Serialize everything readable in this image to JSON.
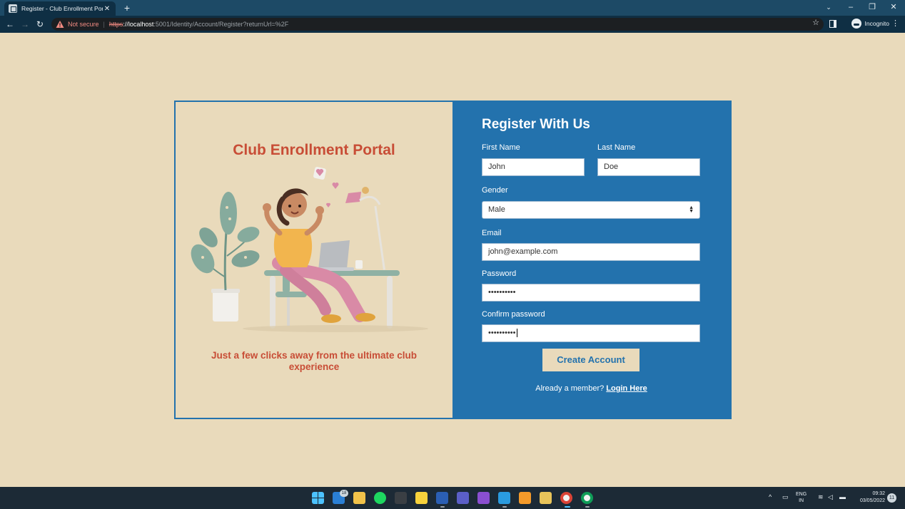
{
  "browser": {
    "tab_title": "Register - Club Enrollment Portal",
    "tab_close": "✕",
    "new_tab": "+",
    "security_label": "Not secure",
    "url_scheme": "https",
    "url_host": "://localhost",
    "url_path": ":5001/Identity/Account/Register?returnUrl=%2F",
    "profile_label": "Incognito"
  },
  "left_panel": {
    "title": "Club Enrollment Portal",
    "tagline": "Just a few clicks away from the ultimate club experience"
  },
  "form": {
    "title": "Register With Us",
    "first_name_label": "First Name",
    "first_name_value": "John",
    "last_name_label": "Last Name",
    "last_name_value": "Doe",
    "gender_label": "Gender",
    "gender_value": "Male",
    "email_label": "Email",
    "email_value": "john@example.com",
    "password_label": "Password",
    "password_value": "••••••••••",
    "confirm_label": "Confirm password",
    "confirm_value": "••••••••••",
    "submit_label": "Create Account",
    "member_text": "Already a member?",
    "login_link": "Login Here"
  },
  "taskbar": {
    "mail_badge": "18",
    "lang_line1": "ENG",
    "lang_line2": "IN",
    "time": "09:32",
    "date": "03/05/2022",
    "notif_count": "11"
  },
  "colors": {
    "page_bg": "#e9dabb",
    "accent_blue": "#2372ad",
    "title_red": "#c84d36"
  }
}
